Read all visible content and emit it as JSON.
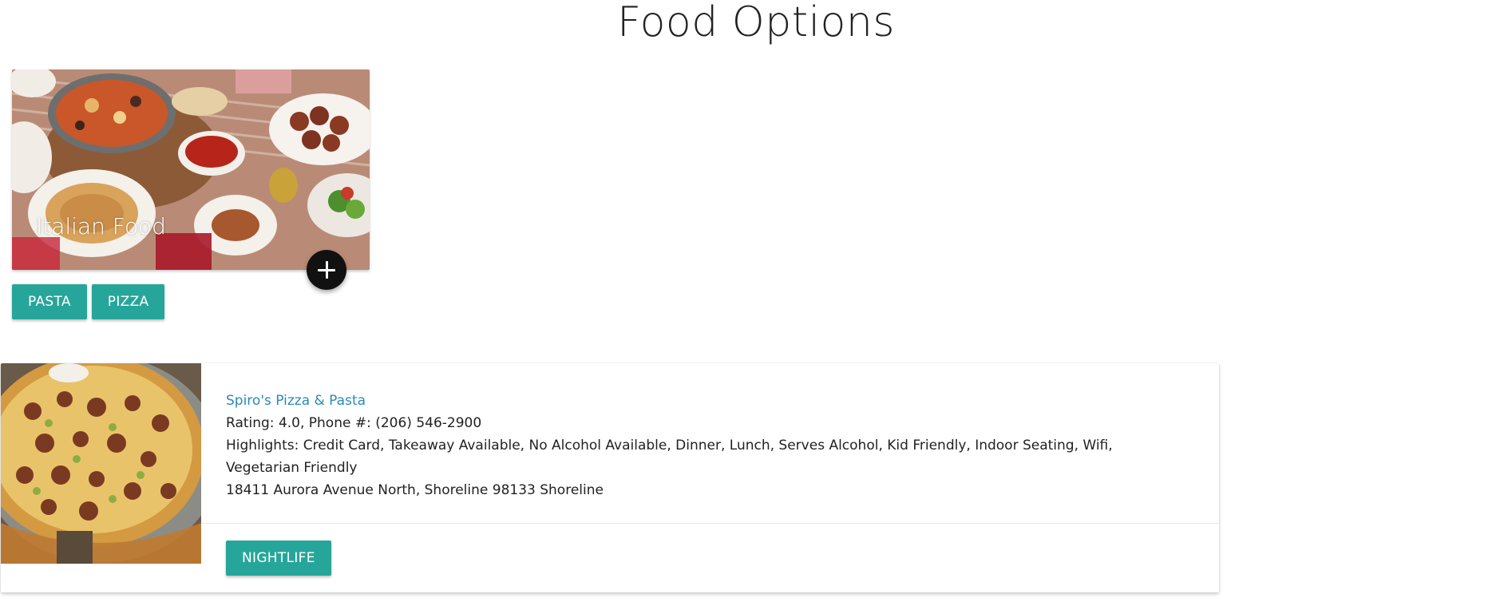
{
  "page": {
    "title": "Food Options"
  },
  "category": {
    "title": "Italian Food",
    "add_icon": "plus-icon",
    "tags": [
      "PASTA",
      "PIZZA"
    ]
  },
  "restaurant": {
    "name": "Spiro's Pizza & Pasta",
    "rating_line": "Rating: 4.0, Phone #: (206) 546-2900",
    "highlights": "Highlights: Credit Card, Takeaway Available, No Alcohol Available, Dinner, Lunch, Serves Alcohol, Kid Friendly, Indoor Seating, Wifi, Vegetarian Friendly",
    "address": "18411 Aurora Avenue North, Shoreline 98133 Shoreline",
    "action_label": "NIGHTLIFE"
  },
  "colors": {
    "accent": "#26a69a",
    "link": "#2a8ab8",
    "fab": "#111111"
  }
}
